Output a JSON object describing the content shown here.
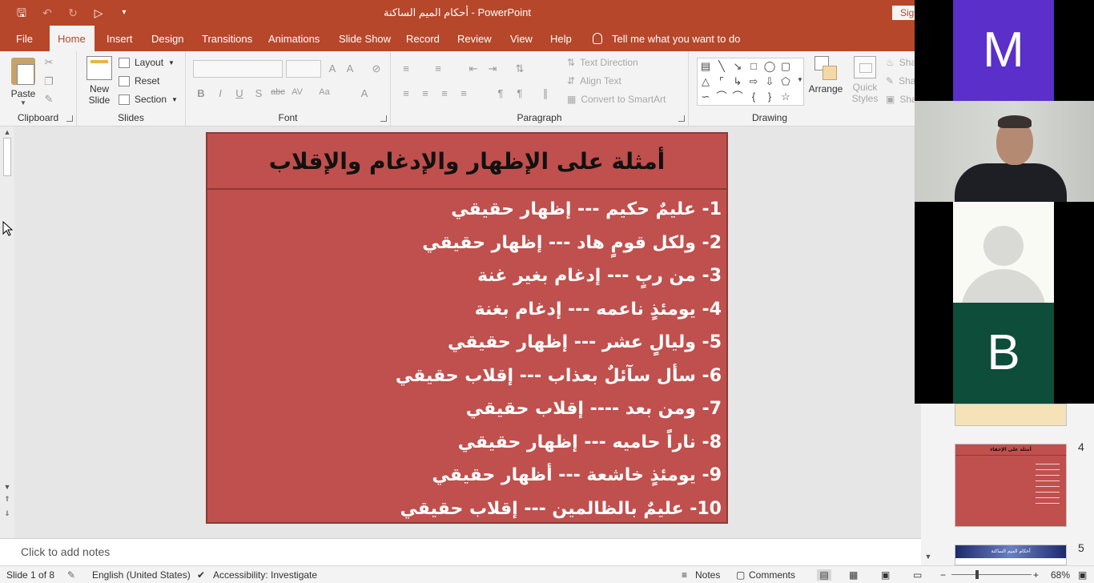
{
  "titlebar": {
    "title": "أحكام الميم الساكنة  -  PowerPoint",
    "signin_label": "Sig"
  },
  "tabs": [
    "File",
    "Home",
    "Insert",
    "Design",
    "Transitions",
    "Animations",
    "Slide Show",
    "Record",
    "Review",
    "View",
    "Help"
  ],
  "tell_me": "Tell me what you want to do",
  "ribbon": {
    "clipboard": {
      "label": "Clipboard",
      "paste": "Paste"
    },
    "slides": {
      "label": "Slides",
      "new_slide_1": "New",
      "new_slide_2": "Slide",
      "layout": "Layout",
      "reset": "Reset",
      "section": "Section"
    },
    "font": {
      "label": "Font"
    },
    "paragraph": {
      "label": "Paragraph",
      "text_direction": "Text Direction",
      "align_text": "Align Text",
      "convert_smartart": "Convert to SmartArt"
    },
    "drawing": {
      "label": "Drawing",
      "arrange": "Arrange",
      "quick_1": "Quick",
      "quick_2": "Styles",
      "shape_fill": "Sha",
      "shape_outline": "Sha",
      "shape_effects": "Sha"
    }
  },
  "slide": {
    "title": "أمثلة على الإظهار والإدغام والإقلاب",
    "lines": [
      "1- عليمٌ حكيم --- إظهار حقيقي",
      "2- ولكل قومٍ هاد --- إظهار حقيقي",
      "3- من ربٍ --- إدغام بغير غنة",
      "4- يومئذٍ ناعمه --- إدغام بغنة",
      "5- وليالٍ عشر --- إظهار حقيقي",
      "6- سأل سآئلٌ بعذاب --- إقلاب حقيقي",
      "7- ومن بعد ---- إقلاب حقيقي",
      "8- ناراً حاميه --- إظهار حقيقي",
      "9- يومئذٍ خاشعة --- أظهار حقيقي",
      "10- عليمٌ بالظالمين --- إقلاب حقيقي"
    ]
  },
  "notes_placeholder": "Click to add notes",
  "thumbnails": {
    "slide4_number": "4",
    "slide4_title": "أمثلة على الإخفاء",
    "slide5_number": "5",
    "slide5_title": "أحكام الميم الساكنة"
  },
  "video": {
    "tile_m_letter": "M",
    "tile_b_letter": "B",
    "tile_m_color": "#5b2fc9",
    "tile_b_color": "#0d4d3a"
  },
  "status": {
    "slide_of": "Slide 1 of 8",
    "language": "English (United States)",
    "accessibility": "Accessibility: Investigate",
    "notes": "Notes",
    "comments": "Comments",
    "zoom": "68%"
  },
  "colors": {
    "accent": "#b7472a",
    "slide_bg": "#c0504d"
  }
}
